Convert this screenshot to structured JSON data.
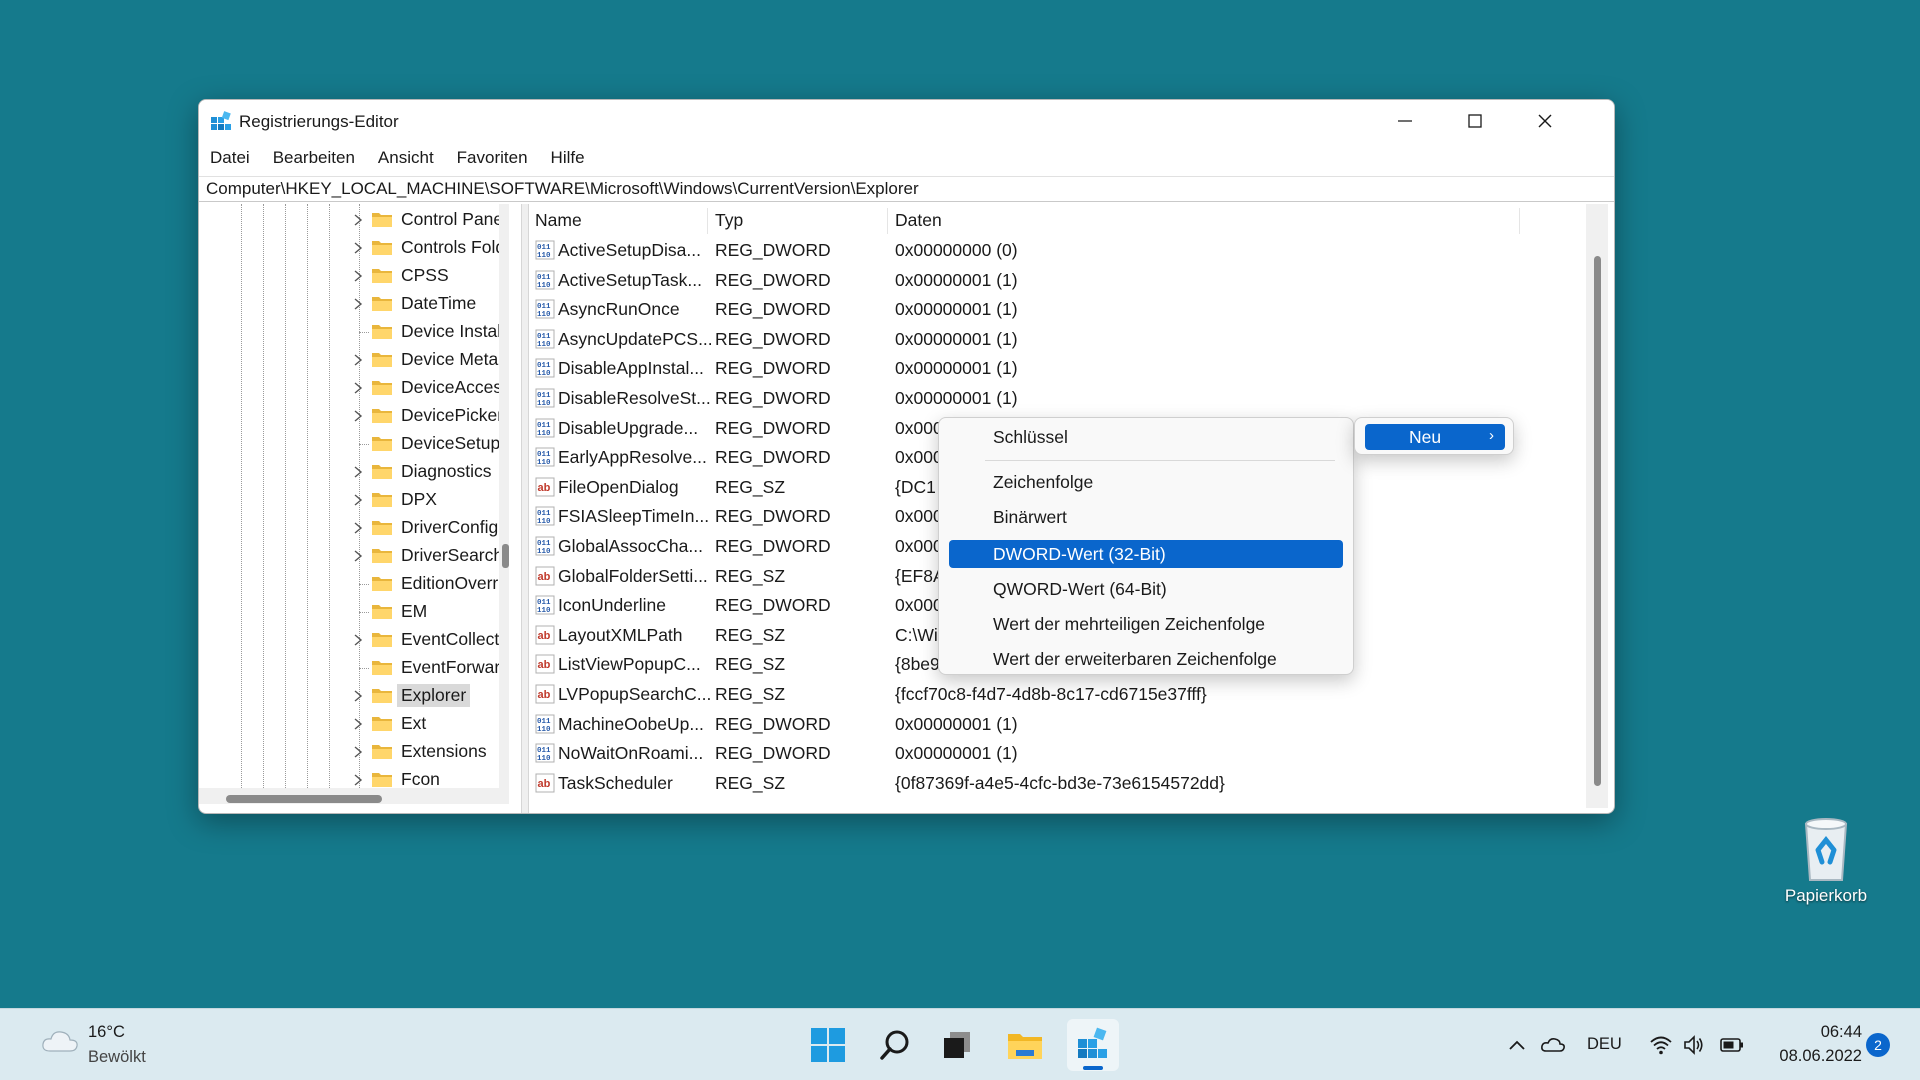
{
  "window": {
    "title": "Registrierungs-Editor",
    "menu": [
      "Datei",
      "Bearbeiten",
      "Ansicht",
      "Favoriten",
      "Hilfe"
    ],
    "address": "Computer\\HKEY_LOCAL_MACHINE\\SOFTWARE\\Microsoft\\Windows\\CurrentVersion\\Explorer"
  },
  "tree": {
    "items": [
      {
        "label": "Control Panel",
        "expandable": true
      },
      {
        "label": "Controls Folder",
        "expandable": true
      },
      {
        "label": "CPSS",
        "expandable": true
      },
      {
        "label": "DateTime",
        "expandable": true
      },
      {
        "label": "Device Installer",
        "expandable": false
      },
      {
        "label": "Device Metadata",
        "expandable": true
      },
      {
        "label": "DeviceAccess",
        "expandable": true
      },
      {
        "label": "DevicePicker",
        "expandable": true
      },
      {
        "label": "DeviceSetup",
        "expandable": false
      },
      {
        "label": "Diagnostics",
        "expandable": true
      },
      {
        "label": "DPX",
        "expandable": true
      },
      {
        "label": "DriverConfig",
        "expandable": true
      },
      {
        "label": "DriverSearching",
        "expandable": true
      },
      {
        "label": "EditionOverrides",
        "expandable": false
      },
      {
        "label": "EM",
        "expandable": false
      },
      {
        "label": "EventCollector",
        "expandable": true
      },
      {
        "label": "EventForwarding",
        "expandable": false
      },
      {
        "label": "Explorer",
        "expandable": true,
        "selected": true
      },
      {
        "label": "Ext",
        "expandable": true
      },
      {
        "label": "Extensions",
        "expandable": true
      },
      {
        "label": "Fcon",
        "expandable": true
      }
    ]
  },
  "list": {
    "columns": {
      "name": "Name",
      "type": "Typ",
      "data": "Daten"
    },
    "rows": [
      {
        "name": "ActiveSetupDisa...",
        "type": "REG_DWORD",
        "data": "0x00000000 (0)",
        "kind": "bin"
      },
      {
        "name": "ActiveSetupTask...",
        "type": "REG_DWORD",
        "data": "0x00000001 (1)",
        "kind": "bin"
      },
      {
        "name": "AsyncRunOnce",
        "type": "REG_DWORD",
        "data": "0x00000001 (1)",
        "kind": "bin"
      },
      {
        "name": "AsyncUpdatePCS...",
        "type": "REG_DWORD",
        "data": "0x00000001 (1)",
        "kind": "bin"
      },
      {
        "name": "DisableAppInstal...",
        "type": "REG_DWORD",
        "data": "0x00000001 (1)",
        "kind": "bin"
      },
      {
        "name": "DisableResolveSt...",
        "type": "REG_DWORD",
        "data": "0x00000001 (1)",
        "kind": "bin"
      },
      {
        "name": "DisableUpgrade...",
        "type": "REG_DWORD",
        "data": "0x000",
        "kind": "bin"
      },
      {
        "name": "EarlyAppResolve...",
        "type": "REG_DWORD",
        "data": "0x000",
        "kind": "bin"
      },
      {
        "name": "FileOpenDialog",
        "type": "REG_SZ",
        "data": "{DC1",
        "kind": "ab"
      },
      {
        "name": "FSIASleepTimeIn...",
        "type": "REG_DWORD",
        "data": "0x000",
        "kind": "bin"
      },
      {
        "name": "GlobalAssocCha...",
        "type": "REG_DWORD",
        "data": "0x000",
        "kind": "bin"
      },
      {
        "name": "GlobalFolderSetti...",
        "type": "REG_SZ",
        "data": "{EF8A",
        "kind": "ab"
      },
      {
        "name": "IconUnderline",
        "type": "REG_DWORD",
        "data": "0x000",
        "kind": "bin"
      },
      {
        "name": "LayoutXMLPath",
        "type": "REG_SZ",
        "data": "C:\\Wi",
        "kind": "ab"
      },
      {
        "name": "ListViewPopupC...",
        "type": "REG_SZ",
        "data": "{8be9",
        "kind": "ab"
      },
      {
        "name": "LVPopupSearchC...",
        "type": "REG_SZ",
        "data": "{fccf70c8-f4d7-4d8b-8c17-cd6715e37fff}",
        "kind": "ab"
      },
      {
        "name": "MachineOobeUp...",
        "type": "REG_DWORD",
        "data": "0x00000001 (1)",
        "kind": "bin"
      },
      {
        "name": "NoWaitOnRoami...",
        "type": "REG_DWORD",
        "data": "0x00000001 (1)",
        "kind": "bin"
      },
      {
        "name": "TaskScheduler",
        "type": "REG_SZ",
        "data": "{0f87369f-a4e5-4cfc-bd3e-73e6154572dd}",
        "kind": "ab"
      }
    ]
  },
  "context_menu": {
    "main_item": "Neu",
    "submenu": {
      "key": "Schlüssel",
      "items": [
        {
          "label": "Zeichenfolge",
          "highlighted": false
        },
        {
          "label": "Binärwert",
          "highlighted": false
        },
        {
          "label": "DWORD-Wert (32-Bit)",
          "highlighted": true
        },
        {
          "label": "QWORD-Wert (64-Bit)",
          "highlighted": false
        },
        {
          "label": "Wert der mehrteiligen Zeichenfolge",
          "highlighted": false
        },
        {
          "label": "Wert der erweiterbaren Zeichenfolge",
          "highlighted": false
        }
      ]
    }
  },
  "desktop": {
    "recycle_bin": "Papierkorb"
  },
  "taskbar": {
    "weather_temp": "16°C",
    "weather_desc": "Bewölkt",
    "language": "DEU",
    "time": "06:44",
    "date": "08.06.2022",
    "notifications": "2",
    "apps": [
      "start-icon",
      "search-icon",
      "task-view-icon",
      "file-explorer-icon",
      "regedit-icon"
    ]
  },
  "colors": {
    "desktop": "#157a8c",
    "accent": "#0a66cc",
    "taskbar": "#dbeaf0"
  }
}
